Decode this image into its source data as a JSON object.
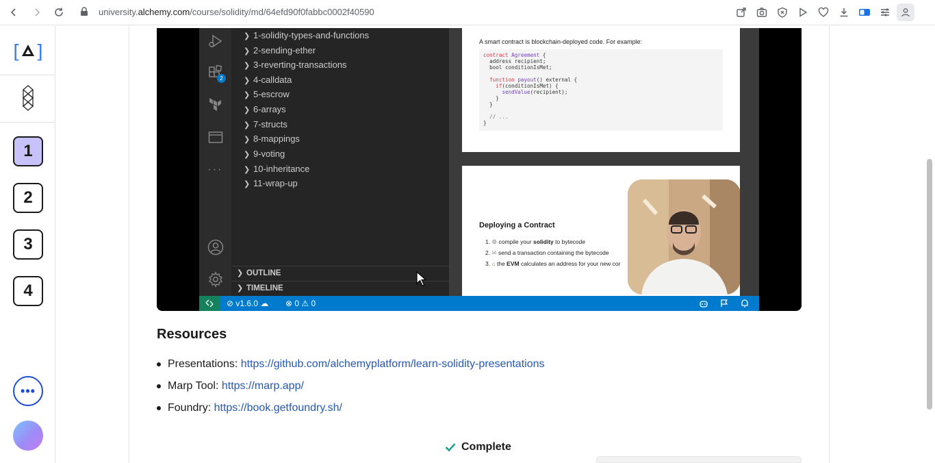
{
  "browser": {
    "url_domain_prefix": "university.",
    "url_domain": "alchemy.com",
    "url_path": "/course/solidity/md/64efd90f0fabbc0002f40590"
  },
  "sidebar": {
    "logo": "[A]",
    "steps": [
      {
        "label": "1",
        "active": true
      },
      {
        "label": "2",
        "active": false
      },
      {
        "label": "3",
        "active": false
      },
      {
        "label": "4",
        "active": false
      }
    ],
    "more_label": "•••"
  },
  "video": {
    "explorer_items": [
      "1-solidity-types-and-functions",
      "2-sending-ether",
      "3-reverting-transactions",
      "4-calldata",
      "5-escrow",
      "6-arrays",
      "7-structs",
      "8-mappings",
      "9-voting",
      "10-inheritance",
      "11-wrap-up"
    ],
    "extensions_badge": "2",
    "panels": [
      "OUTLINE",
      "TIMELINE"
    ],
    "status_version": "v1.6.0",
    "status_errors": "0",
    "status_warnings": "0",
    "slide1": {
      "text": "A smart contract is blockchain-deployed code. For example:"
    },
    "slide2": {
      "title": "Deploying a Contract",
      "items": [
        {
          "n": "1.",
          "pre": "compile your ",
          "bold": "solidity",
          "post": " to bytecode"
        },
        {
          "n": "2.",
          "pre": "send a transaction containing the bytecode",
          "bold": "",
          "post": ""
        },
        {
          "n": "3.",
          "pre": "the ",
          "bold": "EVM",
          "post": " calculates an address for your new cor"
        }
      ]
    }
  },
  "resources": {
    "title": "Resources",
    "items": [
      {
        "label": "Presentations: ",
        "link": "https://github.com/alchemyplatform/learn-solidity-presentations"
      },
      {
        "label": "Marp Tool: ",
        "link": "https://marp.app/"
      },
      {
        "label": "Foundry: ",
        "link": "https://book.getfoundry.sh/"
      }
    ]
  },
  "complete_label": "Complete",
  "colors": {
    "accent": "#2558b5",
    "active_step": "#c8c2fb",
    "vscode_status": "#007acc",
    "complete_check": "#0f9d8a"
  }
}
